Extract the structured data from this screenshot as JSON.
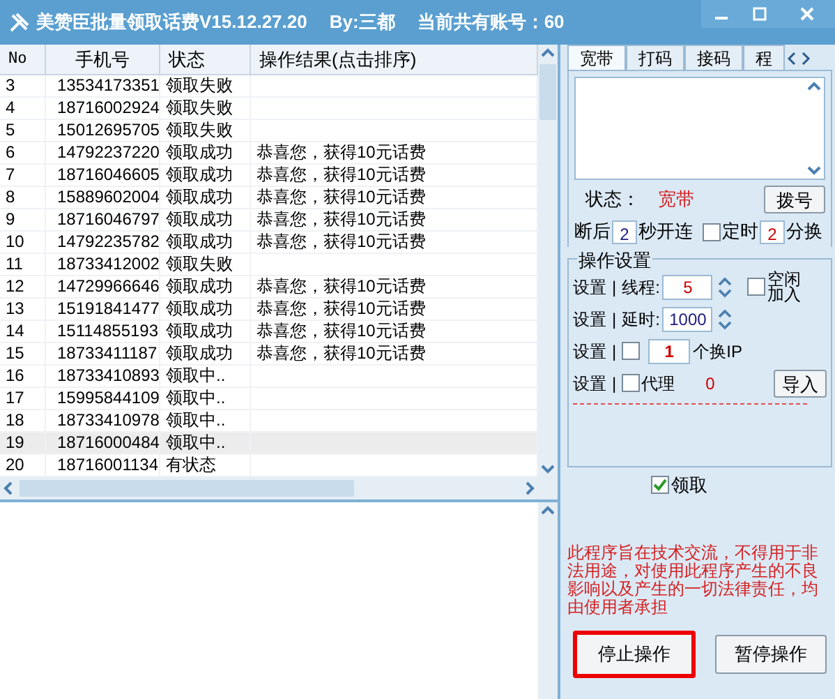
{
  "window": {
    "title": "美赞臣批量领取话费V15.12.27.20",
    "author": "By:三都",
    "account_count": "当前共有账号：60"
  },
  "table": {
    "columns": [
      "No",
      "手机号",
      "状态",
      "操作结果(点击排序)"
    ],
    "rows": [
      {
        "no": "3",
        "phone": "13534173351",
        "status": "领取失败",
        "result": "",
        "selected": false
      },
      {
        "no": "4",
        "phone": "18716002924",
        "status": "领取失败",
        "result": "",
        "selected": false
      },
      {
        "no": "5",
        "phone": "15012695705",
        "status": "领取失败",
        "result": "",
        "selected": false
      },
      {
        "no": "6",
        "phone": "14792237220",
        "status": "领取成功",
        "result": "恭喜您，获得10元话费",
        "selected": false
      },
      {
        "no": "7",
        "phone": "18716046605",
        "status": "领取成功",
        "result": "恭喜您，获得10元话费",
        "selected": false
      },
      {
        "no": "8",
        "phone": "15889602004",
        "status": "领取成功",
        "result": "恭喜您，获得10元话费",
        "selected": false
      },
      {
        "no": "9",
        "phone": "18716046797",
        "status": "领取成功",
        "result": "恭喜您，获得10元话费",
        "selected": false
      },
      {
        "no": "10",
        "phone": "14792235782",
        "status": "领取成功",
        "result": "恭喜您，获得10元话费",
        "selected": false
      },
      {
        "no": "11",
        "phone": "18733412002",
        "status": "领取失败",
        "result": "",
        "selected": false
      },
      {
        "no": "12",
        "phone": "14729966646",
        "status": "领取成功",
        "result": "恭喜您，获得10元话费",
        "selected": false
      },
      {
        "no": "13",
        "phone": "15191841477",
        "status": "领取成功",
        "result": "恭喜您，获得10元话费",
        "selected": false
      },
      {
        "no": "14",
        "phone": "15114855193",
        "status": "领取成功",
        "result": "恭喜您，获得10元话费",
        "selected": false
      },
      {
        "no": "15",
        "phone": "18733411187",
        "status": "领取成功",
        "result": "恭喜您，获得10元话费",
        "selected": false
      },
      {
        "no": "16",
        "phone": "18733410893",
        "status": "领取中..",
        "result": "",
        "selected": false
      },
      {
        "no": "17",
        "phone": "15995844109",
        "status": "领取中..",
        "result": "",
        "selected": false
      },
      {
        "no": "18",
        "phone": "18733410978",
        "status": "领取中..",
        "result": "",
        "selected": false
      },
      {
        "no": "19",
        "phone": "18716000484",
        "status": "领取中..",
        "result": "",
        "selected": true
      },
      {
        "no": "20",
        "phone": "18716001134",
        "status": "有状态",
        "result": "",
        "selected": false
      }
    ]
  },
  "tabs": [
    {
      "label": "宽带",
      "selected": true
    },
    {
      "label": "打码",
      "selected": false
    },
    {
      "label": "接码",
      "selected": false
    },
    {
      "label": "程",
      "selected": false
    }
  ],
  "broadband": {
    "status_label": "状态：",
    "status_value": "宽带",
    "dial_button": "拨号",
    "reconnect_prefix": "断后",
    "reconnect_value": "2",
    "reconnect_suffix": "秒开连",
    "timer": {
      "label": "定时",
      "checked": false,
      "value": "2",
      "suffix": "分换"
    }
  },
  "settings": {
    "title": "操作设置",
    "rows": [
      {
        "kind": "spin",
        "label": "设置",
        "separator": "|",
        "field_label": "线程:",
        "value": "5",
        "color": "#cc0000",
        "option": {
          "label": "空闲加入",
          "checked": false
        }
      },
      {
        "kind": "spin",
        "label": "设置",
        "separator": "|",
        "field_label": "延时:",
        "value": "1000",
        "color": "#1a1a80"
      },
      {
        "kind": "switch_ip",
        "label": "设置",
        "separator": "|",
        "checked": false,
        "value": "1",
        "color": "#cc0000",
        "suffix": "个换IP"
      },
      {
        "kind": "proxy",
        "label": "设置",
        "separator": "|",
        "checked": false,
        "option_label": "代理",
        "value": "0",
        "color": "#cc0000",
        "button": "导入"
      }
    ]
  },
  "claim": {
    "label": "领取",
    "checked": true
  },
  "disclaimer": "此程序旨在技术交流，不得用于非法用途，对使用此程序产生的不良影响以及产生的一切法律责任，均由使用者承担",
  "buttons": [
    {
      "label": "停止操作",
      "highlighted": true
    },
    {
      "label": "暂停操作",
      "highlighted": false
    }
  ]
}
